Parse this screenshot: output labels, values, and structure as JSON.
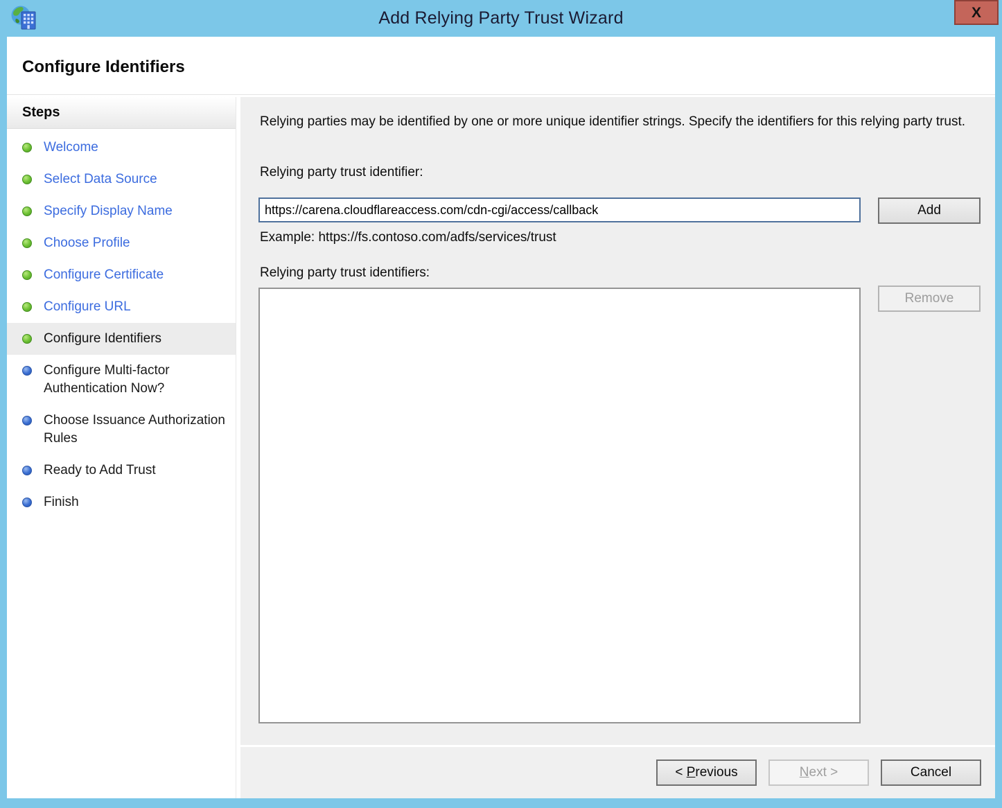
{
  "window": {
    "title": "Add Relying Party Trust Wizard",
    "close_label": "x"
  },
  "page": {
    "heading": "Configure Identifiers"
  },
  "sidebar": {
    "title": "Steps",
    "items": [
      {
        "label": "Welcome",
        "state": "done"
      },
      {
        "label": "Select Data Source",
        "state": "done"
      },
      {
        "label": "Specify Display Name",
        "state": "done"
      },
      {
        "label": "Choose Profile",
        "state": "done"
      },
      {
        "label": "Configure Certificate",
        "state": "done"
      },
      {
        "label": "Configure URL",
        "state": "done"
      },
      {
        "label": "Configure Identifiers",
        "state": "current"
      },
      {
        "label": "Configure Multi-factor Authentication Now?",
        "state": "todo"
      },
      {
        "label": "Choose Issuance Authorization Rules",
        "state": "todo"
      },
      {
        "label": "Ready to Add Trust",
        "state": "todo"
      },
      {
        "label": "Finish",
        "state": "todo"
      }
    ]
  },
  "main": {
    "intro": "Relying parties may be identified by one or more unique identifier strings. Specify the identifiers for this relying party trust.",
    "identifier_label": "Relying party trust identifier:",
    "identifier_value": "https://carena.cloudflareaccess.com/cdn-cgi/access/callback",
    "add_label": "Add",
    "example": "Example: https://fs.contoso.com/adfs/services/trust",
    "identifiers_list_label": "Relying party trust identifiers:",
    "identifiers_list_items": [],
    "remove_label": "Remove"
  },
  "footer": {
    "previous": {
      "pre": "< ",
      "accel": "P",
      "rest": "revious"
    },
    "next": {
      "accel": "N",
      "rest": "ext >"
    },
    "cancel": {
      "label": "Cancel"
    }
  },
  "colors": {
    "titlebar": "#7cc7e8",
    "close_button": "#c4655a",
    "link_blue": "#3c6cdf",
    "done_bullet": "#5fb832",
    "todo_bullet": "#3566c9",
    "current_highlight": "#ececec",
    "content_background": "#efefef",
    "input_focus_border": "#4f719c"
  }
}
